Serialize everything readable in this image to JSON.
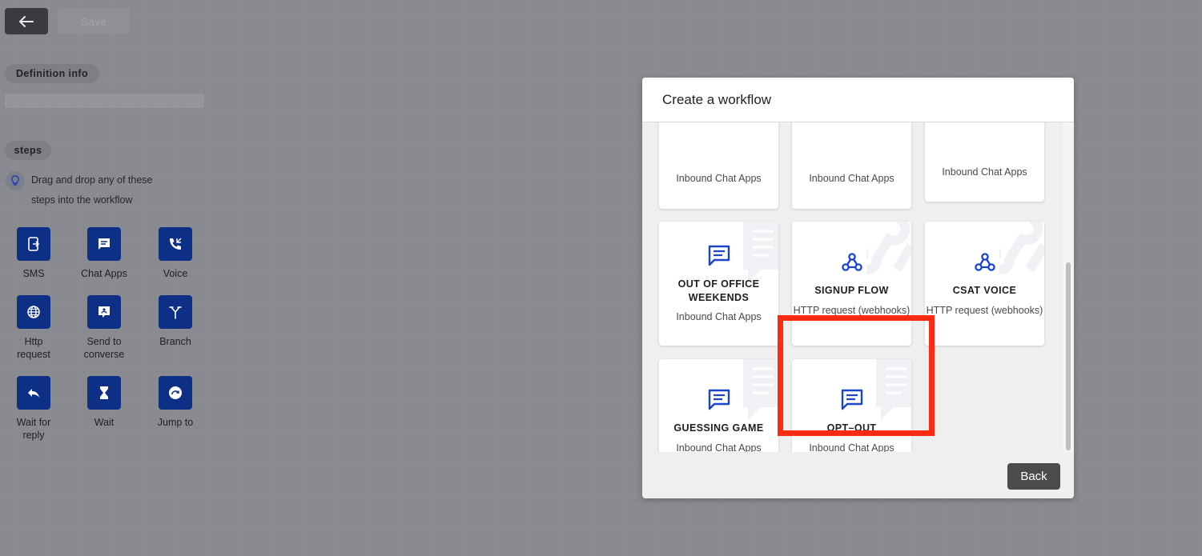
{
  "toolbar": {
    "save_label": "Save",
    "back_icon": "arrow-left-icon"
  },
  "sidebar": {
    "definition_label": "Definition info",
    "steps_label": "steps",
    "hint_line1": "Drag and drop any of these",
    "hint_line2": "steps into the workflow",
    "steps": [
      {
        "label": "SMS",
        "icon": "sms-icon"
      },
      {
        "label": "Chat Apps",
        "icon": "chat-icon"
      },
      {
        "label": "Voice",
        "icon": "phone-icon"
      },
      {
        "label_l1": "Http",
        "label_l2": "request",
        "icon": "globe-icon"
      },
      {
        "label_l1": "Send to",
        "label_l2": "converse",
        "icon": "converse-icon"
      },
      {
        "label": "Branch",
        "icon": "branch-icon"
      },
      {
        "label_l1": "Wait for",
        "label_l2": "reply",
        "icon": "reply-icon"
      },
      {
        "label": "Wait",
        "icon": "hourglass-icon"
      },
      {
        "label": "Jump to",
        "icon": "jump-icon"
      }
    ]
  },
  "modal": {
    "title": "Create a workflow",
    "back_label": "Back",
    "partial_cards": [
      {
        "subtitle": "Inbound Chat Apps"
      },
      {
        "subtitle": "Inbound Chat Apps"
      },
      {
        "subtitle": "Inbound Chat Apps"
      }
    ],
    "cards": [
      {
        "title_l1": "OUT OF OFFICE",
        "title_l2": "WEEKENDS",
        "subtitle": "Inbound Chat Apps",
        "icon": "chat-message-icon"
      },
      {
        "title": "SIGNUP FLOW",
        "subtitle": "HTTP request (webhooks)",
        "icon": "webhook-icon"
      },
      {
        "title": "CSAT VOICE",
        "subtitle": "HTTP request (webhooks)",
        "icon": "webhook-icon"
      },
      {
        "title": "GUESSING GAME",
        "subtitle": "Inbound Chat Apps",
        "icon": "chat-message-icon"
      },
      {
        "title": "OPT–OUT",
        "subtitle": "Inbound Chat Apps",
        "icon": "chat-message-icon"
      }
    ]
  },
  "colors": {
    "step_icon_bg": "#0d2f85",
    "card_icon": "#1a44c9",
    "highlight": "#ff2a12"
  }
}
